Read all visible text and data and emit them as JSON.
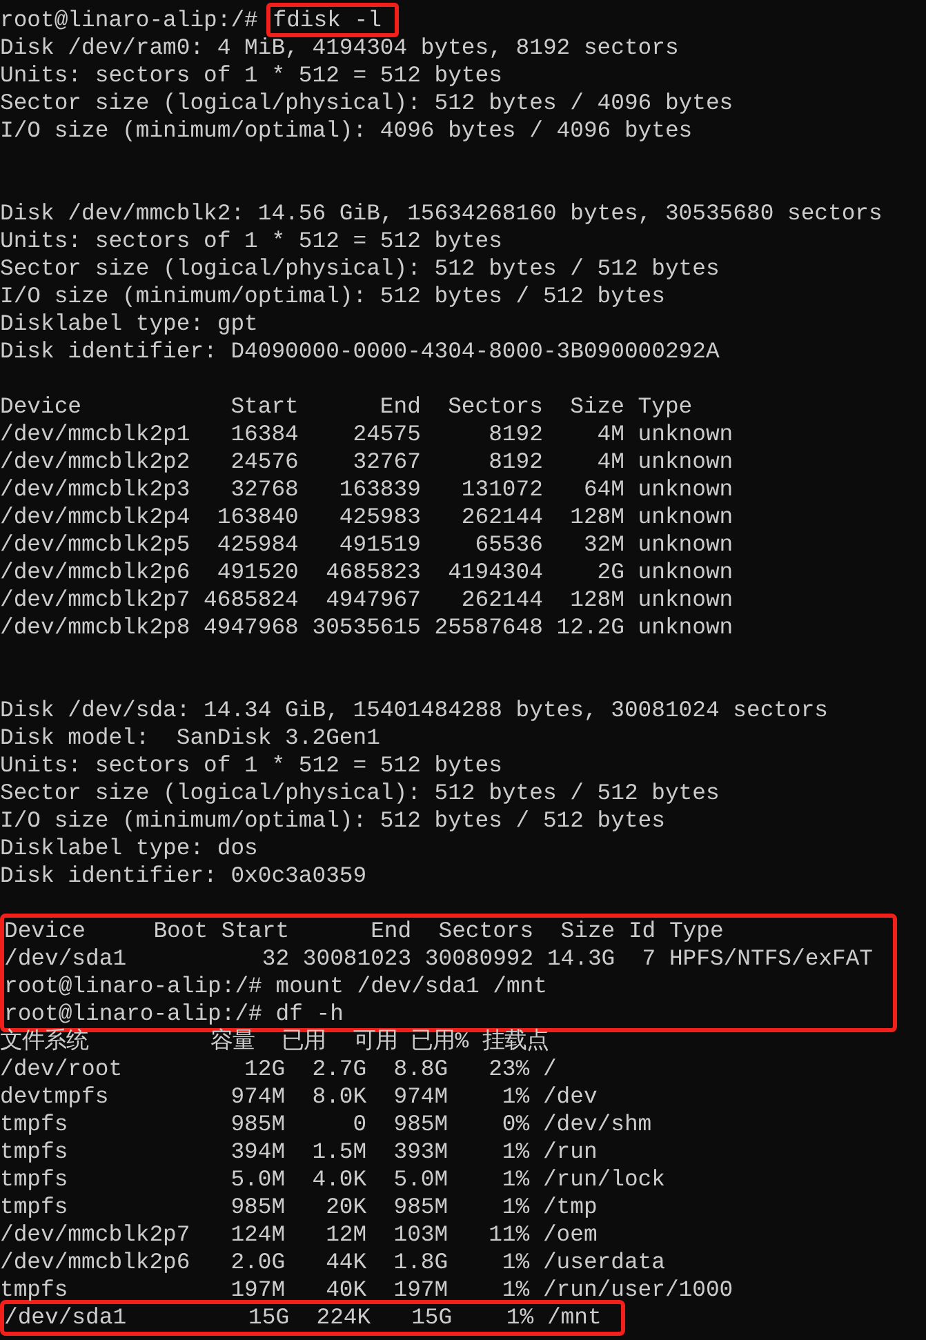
{
  "terminal": {
    "blocks": [
      {
        "boxed": false,
        "lines": [
          {
            "kind": "prompt",
            "prompt": "root@linaro-alip:/#",
            "command": "fdisk -l",
            "command_boxed": true
          },
          {
            "kind": "output",
            "text": "Disk /dev/ram0: 4 MiB, 4194304 bytes, 8192 sectors"
          },
          {
            "kind": "output",
            "text": "Units: sectors of 1 * 512 = 512 bytes"
          },
          {
            "kind": "output",
            "text": "Sector size (logical/physical): 512 bytes / 4096 bytes"
          },
          {
            "kind": "output",
            "text": "I/O size (minimum/optimal): 4096 bytes / 4096 bytes"
          },
          {
            "kind": "blank"
          },
          {
            "kind": "blank"
          },
          {
            "kind": "output",
            "text": "Disk /dev/mmcblk2: 14.56 GiB, 15634268160 bytes, 30535680 sectors"
          },
          {
            "kind": "output",
            "text": "Units: sectors of 1 * 512 = 512 bytes"
          },
          {
            "kind": "output",
            "text": "Sector size (logical/physical): 512 bytes / 512 bytes"
          },
          {
            "kind": "output",
            "text": "I/O size (minimum/optimal): 512 bytes / 512 bytes"
          },
          {
            "kind": "output",
            "text": "Disklabel type: gpt"
          },
          {
            "kind": "output",
            "text": "Disk identifier: D4090000-0000-4304-8000-3B090000292A"
          },
          {
            "kind": "blank"
          },
          {
            "kind": "output",
            "text": "Device           Start      End  Sectors  Size Type"
          },
          {
            "kind": "output",
            "text": "/dev/mmcblk2p1   16384    24575     8192    4M unknown"
          },
          {
            "kind": "output",
            "text": "/dev/mmcblk2p2   24576    32767     8192    4M unknown"
          },
          {
            "kind": "output",
            "text": "/dev/mmcblk2p3   32768   163839   131072   64M unknown"
          },
          {
            "kind": "output",
            "text": "/dev/mmcblk2p4  163840   425983   262144  128M unknown"
          },
          {
            "kind": "output",
            "text": "/dev/mmcblk2p5  425984   491519    65536   32M unknown"
          },
          {
            "kind": "output",
            "text": "/dev/mmcblk2p6  491520  4685823  4194304    2G unknown"
          },
          {
            "kind": "output",
            "text": "/dev/mmcblk2p7 4685824  4947967   262144  128M unknown"
          },
          {
            "kind": "output",
            "text": "/dev/mmcblk2p8 4947968 30535615 25587648 12.2G unknown"
          },
          {
            "kind": "blank"
          },
          {
            "kind": "blank"
          },
          {
            "kind": "output",
            "text": "Disk /dev/sda: 14.34 GiB, 15401484288 bytes, 30081024 sectors"
          },
          {
            "kind": "output",
            "text": "Disk model:  SanDisk 3.2Gen1"
          },
          {
            "kind": "output",
            "text": "Units: sectors of 1 * 512 = 512 bytes"
          },
          {
            "kind": "output",
            "text": "Sector size (logical/physical): 512 bytes / 512 bytes"
          },
          {
            "kind": "output",
            "text": "I/O size (minimum/optimal): 512 bytes / 512 bytes"
          },
          {
            "kind": "output",
            "text": "Disklabel type: dos"
          },
          {
            "kind": "output",
            "text": "Disk identifier: 0x0c3a0359"
          },
          {
            "kind": "blank"
          }
        ]
      },
      {
        "boxed": true,
        "lines": [
          {
            "kind": "output",
            "text": "Device     Boot Start      End  Sectors  Size Id Type"
          },
          {
            "kind": "output",
            "text": "/dev/sda1          32 30081023 30080992 14.3G  7 HPFS/NTFS/exFAT"
          },
          {
            "kind": "prompt",
            "prompt": "root@linaro-alip:/#",
            "command": "mount /dev/sda1 /mnt",
            "command_boxed": false
          },
          {
            "kind": "prompt",
            "prompt": "root@linaro-alip:/#",
            "command": "df -h",
            "command_boxed": false
          }
        ]
      },
      {
        "boxed": false,
        "lines": [
          {
            "kind": "output",
            "text": "文件系统         容量  已用  可用 已用% 挂载点"
          },
          {
            "kind": "output",
            "text": "/dev/root         12G  2.7G  8.8G   23% /"
          },
          {
            "kind": "output",
            "text": "devtmpfs         974M  8.0K  974M    1% /dev"
          },
          {
            "kind": "output",
            "text": "tmpfs            985M     0  985M    0% /dev/shm"
          },
          {
            "kind": "output",
            "text": "tmpfs            394M  1.5M  393M    1% /run"
          },
          {
            "kind": "output",
            "text": "tmpfs            5.0M  4.0K  5.0M    1% /run/lock"
          },
          {
            "kind": "output",
            "text": "tmpfs            985M   20K  985M    1% /tmp"
          },
          {
            "kind": "output",
            "text": "/dev/mmcblk2p7   124M   12M  103M   11% /oem"
          },
          {
            "kind": "output",
            "text": "/dev/mmcblk2p6   2.0G   44K  1.8G    1% /userdata"
          },
          {
            "kind": "output",
            "text": "tmpfs            197M   40K  197M    1% /run/user/1000"
          }
        ]
      },
      {
        "boxed": true,
        "lines": [
          {
            "kind": "output",
            "text": "/dev/sda1         15G  224K   15G    1% /mnt"
          }
        ]
      }
    ]
  }
}
